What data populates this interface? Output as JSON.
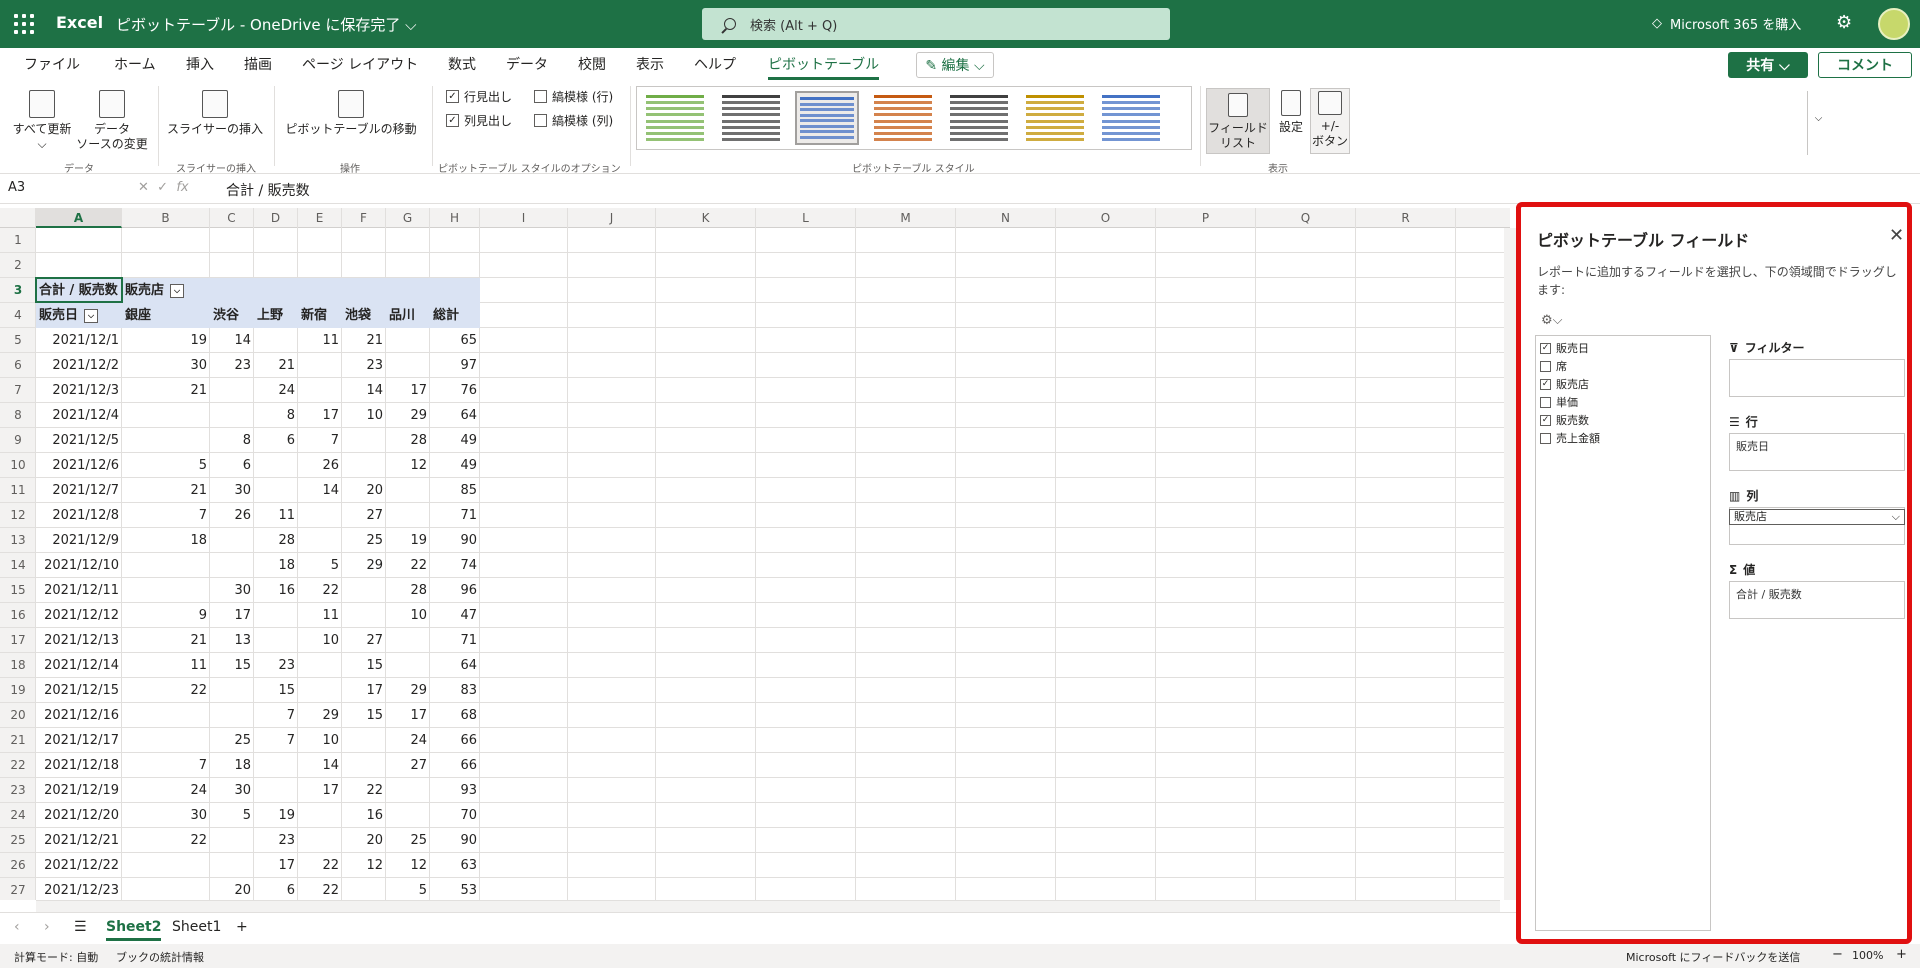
{
  "titlebar": {
    "app": "Excel",
    "doc_title": "ピボットテーブル - OneDrive に保存完了 ⌵",
    "search_placeholder": "検索 (Alt + Q)",
    "m365": "Microsoft 365 を購入",
    "gear": "⚙"
  },
  "menu": [
    "ファイル",
    "ホーム",
    "挿入",
    "描画",
    "ページ レイアウト",
    "数式",
    "データ",
    "校閲",
    "表示",
    "ヘルプ",
    "ピボットテーブル"
  ],
  "edit_label": "✎ 編集 ⌵",
  "share_label": "共有 ⌵",
  "comment_label": "コメント",
  "ribbon": {
    "refresh_all": "すべて更新",
    "refresh_caret": "⌵",
    "change_source_1": "データ",
    "change_source_2": "ソースの変更",
    "group_data": "データ",
    "insert_slicer": "スライサーの挿入",
    "group_slicer": "スライサーの挿入",
    "move_pivot": "ピボットテーブルの移動",
    "group_ops": "操作",
    "row_headers": "行見出し",
    "col_headers": "列見出し",
    "banded_rows": "縞模様 (行)",
    "banded_cols": "縞模様 (列)",
    "group_style_options": "ピボットテーブル スタイルのオプション",
    "group_styles": "ピボットテーブル スタイル",
    "field_list_1": "フィールド",
    "field_list_2": "リスト",
    "settings": "設定",
    "plus_minus_1": "+/-",
    "plus_minus_2": "ボタン",
    "group_show": "表示",
    "style_colors": [
      "#70ad47",
      "#404040",
      "#4472c4",
      "#c55a11",
      "#404040",
      "#bf9000",
      "#4472c4"
    ]
  },
  "formula": {
    "name_box": "A3",
    "text": "合計 / 販売数"
  },
  "columns": [
    "A",
    "B",
    "C",
    "D",
    "E",
    "F",
    "G",
    "H",
    "I",
    "J",
    "K",
    "L",
    "M",
    "N",
    "O",
    "P",
    "Q",
    "R"
  ],
  "row_numbers": [
    "1",
    "2",
    "3",
    "4",
    "5",
    "6",
    "7",
    "8",
    "9",
    "10",
    "11",
    "12",
    "13",
    "14",
    "15",
    "16",
    "17",
    "18",
    "19",
    "20",
    "21",
    "22",
    "23",
    "24",
    "25",
    "26",
    "27"
  ],
  "pivot": {
    "corner_label": "合計 / 販売数",
    "col_field": "販売店",
    "row_field": "販売日",
    "headers": [
      "銀座",
      "渋谷",
      "上野",
      "新宿",
      "池袋",
      "品川",
      "総計"
    ],
    "rows": [
      [
        "2021/12/1",
        "19",
        "14",
        "",
        "11",
        "21",
        "",
        "65"
      ],
      [
        "2021/12/2",
        "30",
        "23",
        "21",
        "",
        "23",
        "",
        "97"
      ],
      [
        "2021/12/3",
        "21",
        "",
        "24",
        "",
        "14",
        "17",
        "76"
      ],
      [
        "2021/12/4",
        "",
        "",
        "8",
        "17",
        "10",
        "29",
        "64"
      ],
      [
        "2021/12/5",
        "",
        "8",
        "6",
        "7",
        "",
        "28",
        "49"
      ],
      [
        "2021/12/6",
        "5",
        "6",
        "",
        "26",
        "",
        "12",
        "49"
      ],
      [
        "2021/12/7",
        "21",
        "30",
        "",
        "14",
        "20",
        "",
        "85"
      ],
      [
        "2021/12/8",
        "7",
        "26",
        "11",
        "",
        "27",
        "",
        "71"
      ],
      [
        "2021/12/9",
        "18",
        "",
        "28",
        "",
        "25",
        "19",
        "90"
      ],
      [
        "2021/12/10",
        "",
        "",
        "18",
        "5",
        "29",
        "22",
        "74"
      ],
      [
        "2021/12/11",
        "",
        "30",
        "16",
        "22",
        "",
        "28",
        "96"
      ],
      [
        "2021/12/12",
        "9",
        "17",
        "",
        "11",
        "",
        "10",
        "47"
      ],
      [
        "2021/12/13",
        "21",
        "13",
        "",
        "10",
        "27",
        "",
        "71"
      ],
      [
        "2021/12/14",
        "11",
        "15",
        "23",
        "",
        "15",
        "",
        "64"
      ],
      [
        "2021/12/15",
        "22",
        "",
        "15",
        "",
        "17",
        "29",
        "83"
      ],
      [
        "2021/12/16",
        "",
        "",
        "7",
        "29",
        "15",
        "17",
        "68"
      ],
      [
        "2021/12/17",
        "",
        "25",
        "7",
        "10",
        "",
        "24",
        "66"
      ],
      [
        "2021/12/18",
        "7",
        "18",
        "",
        "14",
        "",
        "27",
        "66"
      ],
      [
        "2021/12/19",
        "24",
        "30",
        "",
        "17",
        "22",
        "",
        "93"
      ],
      [
        "2021/12/20",
        "30",
        "5",
        "19",
        "",
        "16",
        "",
        "70"
      ],
      [
        "2021/12/21",
        "22",
        "",
        "23",
        "",
        "20",
        "25",
        "90"
      ],
      [
        "2021/12/22",
        "",
        "",
        "17",
        "22",
        "12",
        "12",
        "63"
      ],
      [
        "2021/12/23",
        "",
        "20",
        "6",
        "22",
        "",
        "5",
        "53"
      ]
    ]
  },
  "sheets": [
    "Sheet2",
    "Sheet1"
  ],
  "sheet_add": "+",
  "status": {
    "calc_mode": "計算モード: 自動",
    "workbook_stats": "ブックの統計情報",
    "feedback": "Microsoft にフィードバックを送信",
    "zoom": "100%",
    "zoom_minus": "−",
    "zoom_plus": "+"
  },
  "pane": {
    "title": "ピボットテーブル フィールド",
    "close": "✕",
    "description": "レポートに追加するフィールドを選択し、下の領域間でドラッグします:",
    "tools": "⚙⌵",
    "fields": [
      {
        "name": "販売日",
        "checked": true
      },
      {
        "name": "席",
        "checked": false
      },
      {
        "name": "販売店",
        "checked": true
      },
      {
        "name": "単価",
        "checked": false
      },
      {
        "name": "販売数",
        "checked": true
      },
      {
        "name": "売上金額",
        "checked": false
      }
    ],
    "filter_label": "フィルター",
    "rows_label": "行",
    "rows_value": "販売日",
    "cols_label": "列",
    "cols_value": "販売店",
    "values_label": "値",
    "values_value": "合計 / 販売数"
  }
}
